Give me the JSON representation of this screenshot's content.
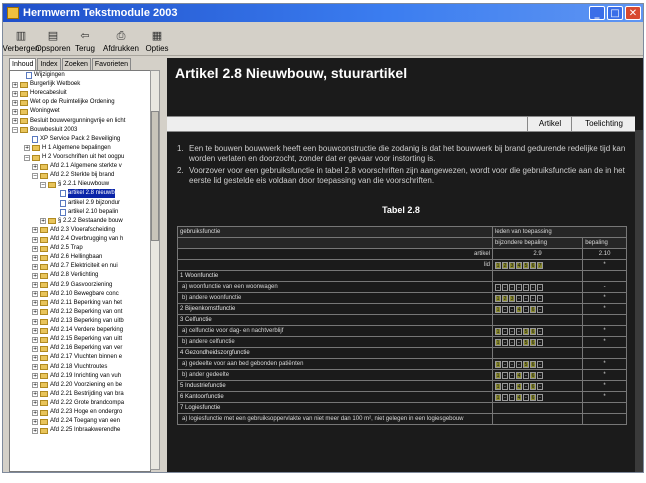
{
  "window": {
    "title": "Hermwerm Tekstmodule 2003",
    "min": "_",
    "max": "□",
    "close": "✕"
  },
  "toolbar": [
    {
      "label": "Verbergen",
      "icon": "hide-icon",
      "glyph": "▥"
    },
    {
      "label": "Opsporen",
      "icon": "locate-icon",
      "glyph": "▤"
    },
    {
      "label": "Terug",
      "icon": "back-icon",
      "glyph": "⇦"
    },
    {
      "label": "Afdrukken",
      "icon": "print-icon",
      "glyph": "⎙"
    },
    {
      "label": "Opties",
      "icon": "options-icon",
      "glyph": "▦"
    }
  ],
  "left_tabs": [
    "Inhoud",
    "Index",
    "Zoeken",
    "Favorieten"
  ],
  "tree": [
    {
      "label": "Wijzigingen",
      "exp": "",
      "icon": "doc"
    },
    {
      "label": "Burgerlijk Wetboek",
      "exp": "+",
      "icon": "fold"
    },
    {
      "label": "Horecabesluit",
      "exp": "+",
      "icon": "fold"
    },
    {
      "label": "Wet op de Ruimtelijke Ordening",
      "exp": "+",
      "icon": "fold"
    },
    {
      "label": "Woningwet",
      "exp": "+",
      "icon": "fold"
    },
    {
      "label": "Besluit bouwvergunningvrije en licht",
      "exp": "+",
      "icon": "fold"
    },
    {
      "label": "Bouwbesluit 2003",
      "exp": "−",
      "icon": "fold"
    },
    {
      "label": "XP Service Pack 2 Beveiliging",
      "exp": "",
      "icon": "doc"
    },
    {
      "label": "H 1 Algemene bepalingen",
      "exp": "+",
      "icon": "fold"
    },
    {
      "label": "H 2 Voorschriften uit het oogpu",
      "exp": "−",
      "icon": "fold"
    },
    {
      "label": "Afd 2.1 Algemene sterkte v",
      "exp": "+",
      "icon": "fold"
    },
    {
      "label": "Afd 2.2 Sterkte bij brand",
      "exp": "−",
      "icon": "fold"
    },
    {
      "label": "§ 2.2.1 Nieuwbouw",
      "exp": "−",
      "icon": "fold"
    },
    {
      "label": "artikel 2.8 nieuwb",
      "exp": "",
      "icon": "doc",
      "sel": true
    },
    {
      "label": "artikel 2.9 bijzondur",
      "exp": "",
      "icon": "doc"
    },
    {
      "label": "artikel 2.10 bepalin",
      "exp": "",
      "icon": "doc"
    },
    {
      "label": "§ 2.2.2 Bestaande bouw",
      "exp": "+",
      "icon": "fold"
    },
    {
      "label": "Afd 2.3 Vloerafscheiding",
      "exp": "+",
      "icon": "fold"
    },
    {
      "label": "Afd 2.4 Overbrugging van h",
      "exp": "+",
      "icon": "fold"
    },
    {
      "label": "Afd 2.5 Trap",
      "exp": "+",
      "icon": "fold"
    },
    {
      "label": "Afd 2.6 Hellingbaan",
      "exp": "+",
      "icon": "fold"
    },
    {
      "label": "Afd 2.7 Elektriciteit en nui",
      "exp": "+",
      "icon": "fold"
    },
    {
      "label": "Afd 2.8 Verlichting",
      "exp": "+",
      "icon": "fold"
    },
    {
      "label": "Afd 2.9 Gasvoorziening",
      "exp": "+",
      "icon": "fold"
    },
    {
      "label": "Afd 2.10 Bewegbare conc",
      "exp": "+",
      "icon": "fold"
    },
    {
      "label": "Afd 2.11 Beperking van het",
      "exp": "+",
      "icon": "fold"
    },
    {
      "label": "Afd 2.12 Beperking van ont",
      "exp": "+",
      "icon": "fold"
    },
    {
      "label": "Afd 2.13 Beperking van uitb",
      "exp": "+",
      "icon": "fold"
    },
    {
      "label": "Afd 2.14 Verdere beperking",
      "exp": "+",
      "icon": "fold"
    },
    {
      "label": "Afd 2.15 Beperking van uitt",
      "exp": "+",
      "icon": "fold"
    },
    {
      "label": "Afd 2.16 Beperking van ver",
      "exp": "+",
      "icon": "fold"
    },
    {
      "label": "Afd 2.17 Vluchten binnen e",
      "exp": "+",
      "icon": "fold"
    },
    {
      "label": "Afd 2.18 Vluchtroutes",
      "exp": "+",
      "icon": "fold"
    },
    {
      "label": "Afd 2.19 Inrichting van vuh",
      "exp": "+",
      "icon": "fold"
    },
    {
      "label": "Afd 2.20 Voorziening en be",
      "exp": "+",
      "icon": "fold"
    },
    {
      "label": "Afd 2.21 Bestrijding van bra",
      "exp": "+",
      "icon": "fold"
    },
    {
      "label": "Afd 2.22 Grote brandcompa",
      "exp": "+",
      "icon": "fold"
    },
    {
      "label": "Afd 2.23 Hoge en ondergro",
      "exp": "+",
      "icon": "fold"
    },
    {
      "label": "Afd 2.24 Toegang van een",
      "exp": "+",
      "icon": "fold"
    },
    {
      "label": "Afd 2.25 Inbraakwerendhe",
      "exp": "+",
      "icon": "fold"
    }
  ],
  "article": {
    "title": "Artikel 2.8 Nieuwbouw, stuurartikel",
    "tabs": [
      "Artikel",
      "Toelichting"
    ],
    "paragraphs": [
      {
        "n": "1.",
        "text": "Een te bouwen bouwwerk heeft een bouwconstructie die zodanig is dat het bouwwerk bij brand gedurende redelijke tijd kan worden verlaten en doorzocht, zonder dat er gevaar voor instorting is."
      },
      {
        "n": "2.",
        "text": "Voorzover voor een gebruiksfunctie in tabel 2.8 voorschriften zijn aangewezen, wordt voor die gebruiksfunctie aan de in het eerste lid gestelde eis voldaan door toepassing van die voorschriften."
      }
    ],
    "table_title": "Tabel 2.8"
  },
  "table": {
    "head1": [
      "gebruiksfunctie",
      "leden van toepassing"
    ],
    "head2": [
      "bijzondere bepaling",
      "bepaling"
    ],
    "artikel_label": "artikel",
    "artikel_values": [
      "2.9",
      "2.10"
    ],
    "lid_label": "lid",
    "lid_values": [
      "1",
      "2",
      "3",
      "4",
      "5",
      "6",
      "7"
    ],
    "lid_star": "*",
    "rows": [
      {
        "label": "1 Woonfunctie",
        "type": "sect",
        "codes": [],
        "end": ""
      },
      {
        "label": "a) woonfunctie van een woonwagen",
        "type": "sub",
        "codes": [
          "-",
          "-",
          "-",
          "-",
          "-",
          "-",
          "-"
        ],
        "end": "-"
      },
      {
        "label": "b) andere woonfunctie",
        "type": "sub",
        "codes": [
          "1",
          "2",
          "3",
          "-",
          "-",
          "-",
          "-"
        ],
        "end": "*"
      },
      {
        "label": "2 Bijeenkomstfunctie",
        "type": "sect",
        "codes": [
          "1",
          "-",
          "-",
          "4",
          "-",
          "6",
          "-"
        ],
        "end": "*"
      },
      {
        "label": "3 Celfunctie",
        "type": "sect",
        "codes": [],
        "end": ""
      },
      {
        "label": "a) celfunctie voor dag- en nachtverblijf",
        "type": "sub",
        "codes": [
          "1",
          "-",
          "-",
          "-",
          "5",
          "6",
          "-"
        ],
        "end": "*"
      },
      {
        "label": "b) andere celfunctie",
        "type": "sub",
        "codes": [
          "1",
          "-",
          "-",
          "-",
          "5",
          "6",
          "-"
        ],
        "end": "*"
      },
      {
        "label": "4 Gezondheidszorgfunctie",
        "type": "sect",
        "codes": [],
        "end": ""
      },
      {
        "label": "a) gedeelte voor aan bed gebonden patiënten",
        "type": "sub",
        "codes": [
          "1",
          "-",
          "-",
          "-",
          "5",
          "6",
          "-"
        ],
        "end": "*"
      },
      {
        "label": "b) ander gedeelte",
        "type": "sub",
        "codes": [
          "1",
          "-",
          "-",
          "4",
          "-",
          "6",
          "-"
        ],
        "end": "*"
      },
      {
        "label": "5 Industriefunctie",
        "type": "sect",
        "codes": [
          "1",
          "-",
          "-",
          "4",
          "-",
          "6",
          "-"
        ],
        "end": "*"
      },
      {
        "label": "6 Kantoorfunctie",
        "type": "sect",
        "codes": [
          "1",
          "-",
          "-",
          "4",
          "-",
          "6",
          "-"
        ],
        "end": "*"
      },
      {
        "label": "7 Logiesfunctie",
        "type": "sect",
        "codes": [],
        "end": ""
      },
      {
        "label": "a) logiesfunctie met een gebruiksoppervlakte van niet meer dan 100 m², niet gelegen in een logiesgebouw",
        "type": "sub",
        "codes": [],
        "end": ""
      }
    ]
  },
  "colors": {
    "main_bg": "#1b1b1b",
    "selection": "#0a24a8",
    "titlebar": "#1f4fc9"
  }
}
